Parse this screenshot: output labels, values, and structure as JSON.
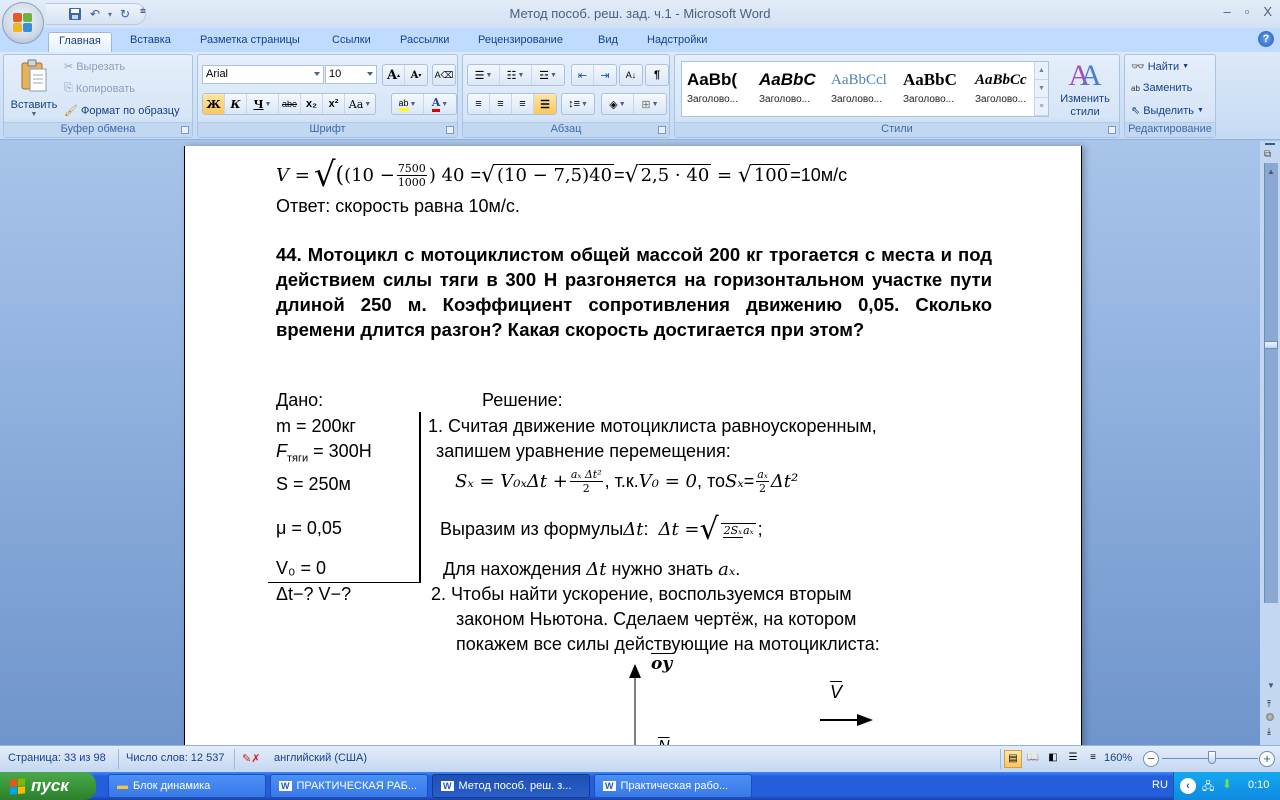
{
  "window": {
    "title": "Метод пособ. реш. зад. ч.1 - Microsoft Word",
    "minimize": "–",
    "maximize": "▫",
    "close": "X"
  },
  "ribbon_tabs": [
    "Главная",
    "Вставка",
    "Разметка страницы",
    "Ссылки",
    "Рассылки",
    "Рецензирование",
    "Вид",
    "Надстройки"
  ],
  "active_tab": "Главная",
  "clipboard": {
    "paste": "Вставить",
    "cut": "Вырезать",
    "copy": "Копировать",
    "format_painter": "Формат по образцу",
    "label": "Буфер обмена"
  },
  "font": {
    "name": "Arial",
    "size": "10",
    "bold": "Ж",
    "italic": "К",
    "underline": "Ч",
    "strike": "abe",
    "subscript": "x₂",
    "superscript": "x²",
    "case": "Aa",
    "grow": "A",
    "shrink": "A",
    "label": "Шрифт",
    "highlight_color": "#ffff00",
    "font_color": "#e00000"
  },
  "paragraph": {
    "label": "Абзац"
  },
  "styles": {
    "items": [
      {
        "preview": "AaBb(",
        "name": "Заголово..."
      },
      {
        "preview": "AaBbC",
        "name": "Заголово..."
      },
      {
        "preview": "AaBbCcl",
        "name": "Заголово..."
      },
      {
        "preview": "AaBbC",
        "name": "Заголово..."
      },
      {
        "preview": "AaBbCc",
        "name": "Заголово..."
      }
    ],
    "change_styles": "Изменить стили",
    "label": "Стили"
  },
  "editing": {
    "find": "Найти",
    "replace": "Заменить",
    "select": "Выделить",
    "label": "Редактирование"
  },
  "document": {
    "eq_top": {
      "v": "V =",
      "num": "7500",
      "den": "1000",
      "part1": "(10 −",
      "part1b": ") 40",
      "eq2": "=",
      "sqrt2": "(10 − 7,5)40",
      "eq3": "=",
      "sqrt3": "2,5 · 40",
      "eq4": " = ",
      "sqrt4": "100",
      "result": "=10м/с"
    },
    "answer": "Ответ: скорость равна 10м/с.",
    "problem": "44. Мотоцикл с мотоциклистом общей массой 200 кг  трогается с места и под действием силы тяги в 300 Н  разгоняется  на горизонтальном участке пути  длиной 250 м.  Коэффициент сопротивления движению 0,05. Сколько времени длится разгон? Какая скорость достигается при этом?",
    "given_title": "Дано:",
    "solution_title": "Решение:",
    "given": [
      "m = 200кг",
      "F",
      "S = 250м",
      "μ = 0,05",
      "V₀ = 0"
    ],
    "given_f_sub": "тяги",
    "given_f_val": " = 300Н",
    "find": "Δt−? V−?",
    "step1_a": "1. Считая движение мотоциклиста равноускоренным,",
    "step1_b": "запишем уравнение перемещения:",
    "formula1_left": "Sₓ = V₀ₓΔt + ",
    "formula1_num": "aₓ Δt²",
    "formula1_den": "2",
    "formula1_mid": ", т.к. ",
    "formula1_v0": "V₀ = 0",
    "formula1_to": ", то ",
    "formula1_sx": "Sₓ",
    "formula1_eq": "=",
    "formula1_num2": "aₓ",
    "formula1_den2": "2",
    "formula1_end": "Δt²",
    "express_text": "Выразим из формулы ",
    "express_dt": "Δt",
    "express_colon": ":  ",
    "express_lhs": "Δt = ",
    "express_num": "2Sₓ",
    "express_den": "aₓ",
    "express_end": ";",
    "need_text": "Для нахождения ",
    "need_dt": "Δt",
    "need_mid": " нужно знать ",
    "need_ax": "aₓ",
    "need_end": ".",
    "step2_a": "2. Чтобы найти ускорение, воспользуемся вторым",
    "step2_b": "законом Ньютона. Сделаем чертёж, на котором",
    "step2_c": "покажем все силы действующие на мотоциклиста:",
    "axis_label": "oy",
    "velocity_label": "V",
    "normal_label": "N"
  },
  "statusbar": {
    "page": "Страница: 33 из 98",
    "words": "Число слов: 12 537",
    "language": "английский (США)",
    "zoom": "160%",
    "zoom_level_percent": 160
  },
  "taskbar": {
    "start": "пуск",
    "tasks": [
      {
        "label": "Блок динамика",
        "icon": "folder-icon",
        "active": false
      },
      {
        "label": "ПРАКТИЧЕСКАЯ РАБ...",
        "icon": "word-icon",
        "active": false
      },
      {
        "label": "Метод пособ. реш. з...",
        "icon": "word-icon",
        "active": true
      },
      {
        "label": "Практическая рабо...",
        "icon": "word-icon",
        "active": false
      }
    ],
    "lang": "RU",
    "clock": "0:10"
  }
}
